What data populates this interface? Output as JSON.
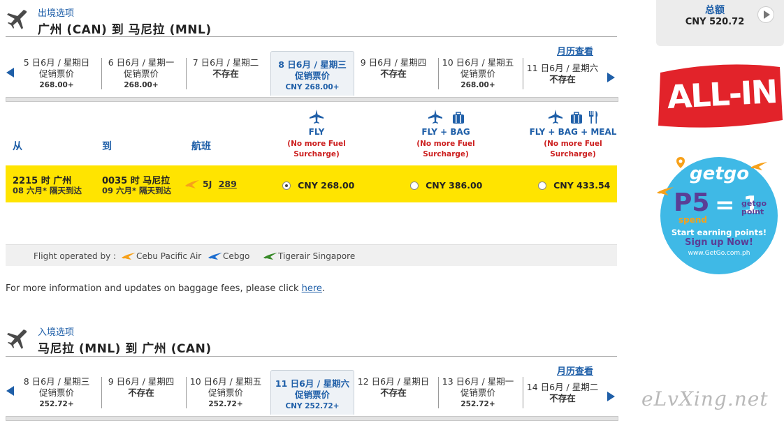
{
  "outbound": {
    "section_label": "出境选项",
    "route": "广州 (CAN) 到 马尼拉 (MNL)",
    "calendar_link": "月历查看",
    "dates": [
      {
        "label": "5 日6月 / 星期日",
        "status": "促销票价",
        "price": "268.00+"
      },
      {
        "label": "6 日6月 / 星期一",
        "status": "促销票价",
        "price": "268.00+"
      },
      {
        "label": "7 日6月 / 星期二",
        "status": "不存在",
        "price": ""
      },
      {
        "label": "8 日6月 / 星期三",
        "status": "促销票价",
        "price": "CNY 268.00+"
      },
      {
        "label": "9 日6月 / 星期四",
        "status": "不存在",
        "price": ""
      },
      {
        "label": "10 日6月 / 星期五",
        "status": "促销票价",
        "price": "268.00+"
      },
      {
        "label": "11 日6月 / 星期六",
        "status": "不存在",
        "price": ""
      }
    ],
    "selected_index": 3
  },
  "table": {
    "col_from": "从",
    "col_to": "到",
    "col_flight": "航班",
    "fares": [
      {
        "name": "FLY",
        "note1": "(No more Fuel",
        "note2": "Surcharge)"
      },
      {
        "name": "FLY + BAG",
        "note1": "(No more Fuel",
        "note2": "Surcharge)"
      },
      {
        "name": "FLY + BAG + MEAL",
        "note1": "(No more Fuel",
        "note2": "Surcharge)"
      }
    ],
    "flight": {
      "depart_time": "2215 时  广州",
      "depart_date": "08 六月*  隔天到达",
      "arrive_time": "0035 时  马尼拉",
      "arrive_date": "09 六月*  隔天到达",
      "airline_code": "5J",
      "flight_no": "289",
      "prices": [
        "CNY 268.00",
        "CNY 386.00",
        "CNY 433.54"
      ],
      "selected_fare": 0
    }
  },
  "operated": {
    "label": "Flight operated by :",
    "carriers": [
      "Cebu Pacific Air",
      "Cebgo",
      "Tigerair Singapore"
    ],
    "carrier_colors": [
      "#f7a11a",
      "#1f6fd0",
      "#3a8a2a"
    ]
  },
  "baggage_info": {
    "text": "For more information and updates on baggage fees, please click ",
    "link": "here",
    "end": "."
  },
  "inbound": {
    "section_label": "入境选项",
    "route": "马尼拉 (MNL) 到 广州 (CAN)",
    "calendar_link": "月历查看",
    "dates": [
      {
        "label": "8 日6月 / 星期三",
        "status": "促销票价",
        "price": "252.72+"
      },
      {
        "label": "9 日6月 / 星期四",
        "status": "不存在",
        "price": ""
      },
      {
        "label": "10 日6月 / 星期五",
        "status": "促销票价",
        "price": "252.72+"
      },
      {
        "label": "11 日6月 / 星期六",
        "status": "促销票价",
        "price": "CNY 252.72+"
      },
      {
        "label": "12 日6月 / 星期日",
        "status": "不存在",
        "price": ""
      },
      {
        "label": "13 日6月 / 星期一",
        "status": "促销票价",
        "price": "252.72+"
      },
      {
        "label": "14 日6月 / 星期二",
        "status": "不存在",
        "price": ""
      }
    ],
    "selected_index": 3
  },
  "summary": {
    "total_label": "总额",
    "total_value": "CNY  520.72"
  },
  "ads": {
    "allin": "ALL-IN",
    "getgo_brand": "getgo",
    "getgo_p5": "P5",
    "getgo_spend": "spend",
    "getgo_eq": "= 1",
    "getgo_point1": "getgo",
    "getgo_point2": "point",
    "getgo_line1": "Start earning points!",
    "getgo_line2": "Sign up Now!",
    "getgo_url": "www.GetGo.com.ph"
  },
  "watermark": "eLvXing.net",
  "colors": {
    "accent": "#1f5fa8",
    "highlight": "#ffe400",
    "alert": "#cc1f1f",
    "brand_red": "#e2232a"
  }
}
